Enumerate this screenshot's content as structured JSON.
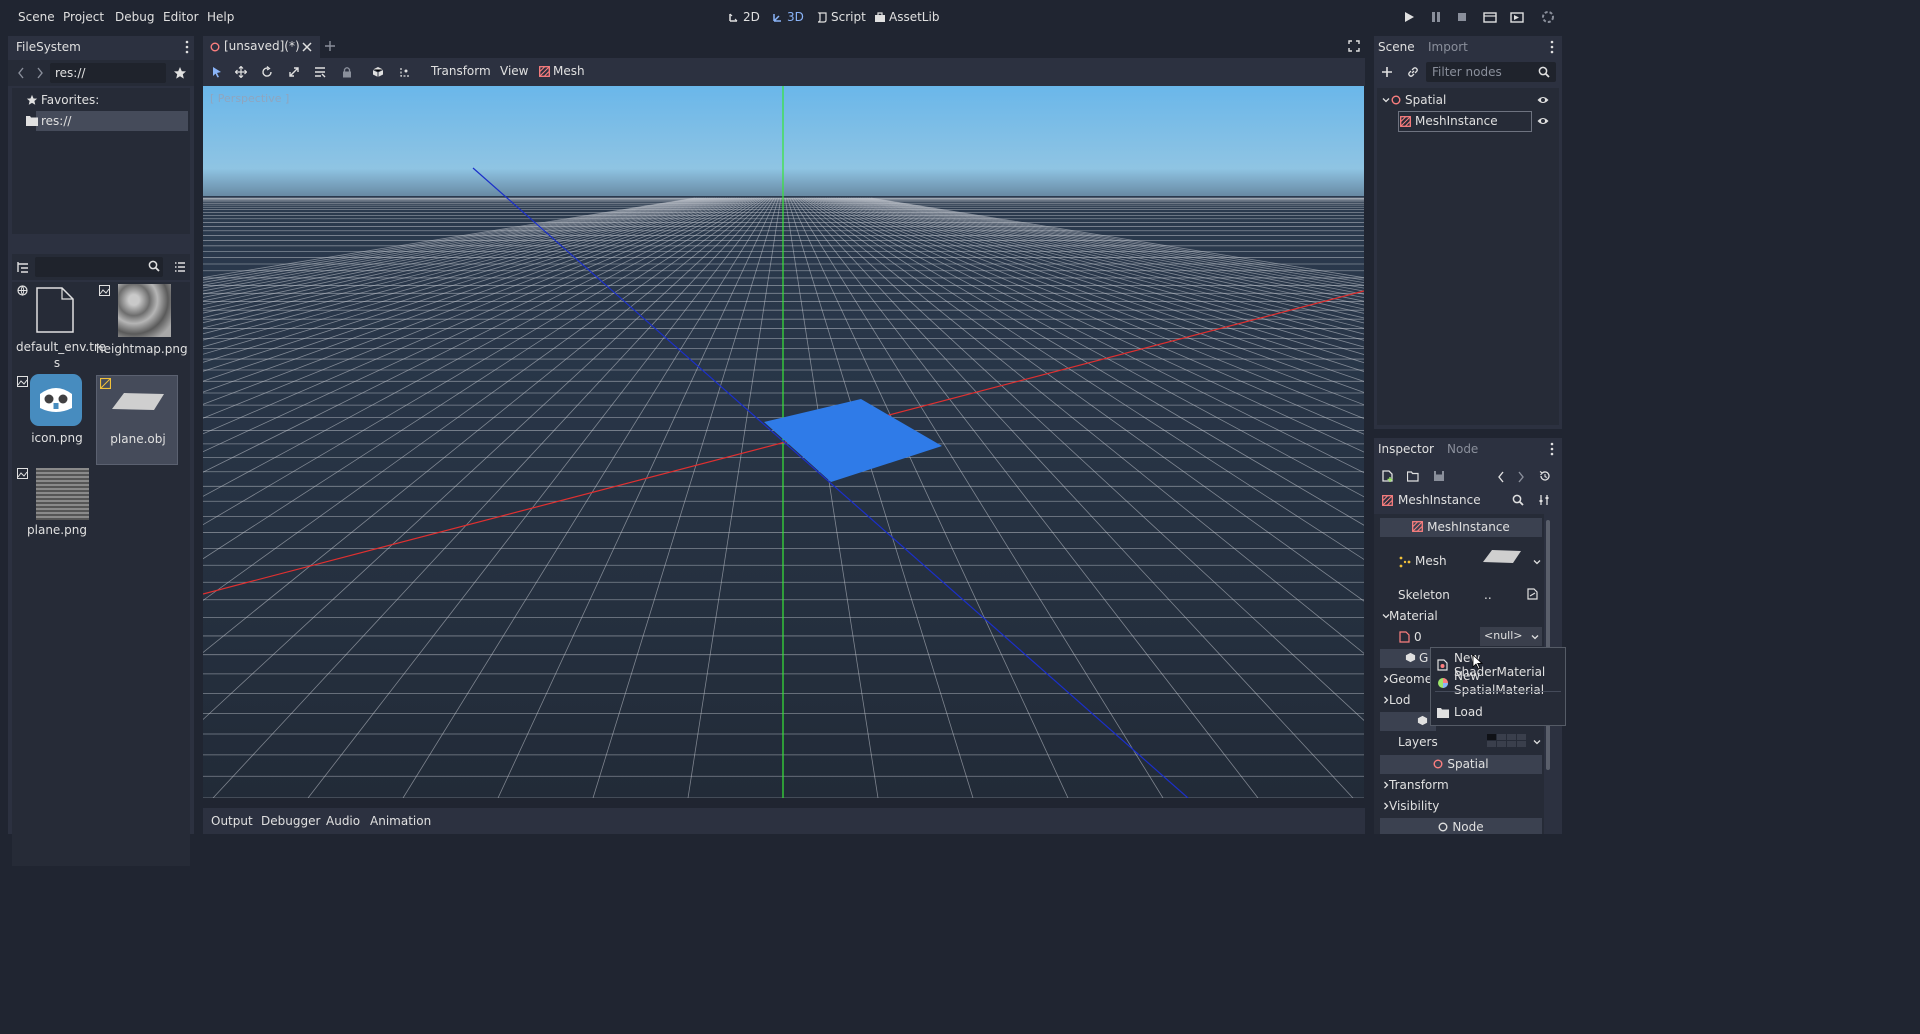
{
  "menu": {
    "items": [
      "Scene",
      "Project",
      "Debug",
      "Editor",
      "Help"
    ]
  },
  "workspaces": {
    "items": [
      "2D",
      "3D",
      "Script",
      "AssetLib"
    ]
  },
  "filesystem": {
    "title": "FileSystem",
    "path": "res://",
    "favorites_label": "Favorites:",
    "root_label": "res://",
    "files": [
      {
        "name": "default_env.tres",
        "line1": "default_env.tre",
        "line2": "s"
      },
      {
        "name": "heightmap.png"
      },
      {
        "name": "icon.png"
      },
      {
        "name": "plane.obj"
      },
      {
        "name": "plane.png"
      }
    ]
  },
  "editor": {
    "tab_label": "[unsaved](*)",
    "toolbar": {
      "transform": "Transform",
      "view": "View",
      "mesh": "Mesh"
    },
    "viewport_label": "[ Perspective ]",
    "bottom_tabs": [
      "Output",
      "Debugger",
      "Audio",
      "Animation"
    ]
  },
  "scene_panel": {
    "tabs": [
      "Scene",
      "Import"
    ],
    "filter_placeholder": "Filter nodes",
    "tree": [
      {
        "label": "Spatial"
      },
      {
        "label": "MeshInstance"
      }
    ]
  },
  "inspector": {
    "tabs": [
      "Inspector",
      "Node"
    ],
    "object_name": "MeshInstance",
    "section_meshinstance": "MeshInstance",
    "mesh_label": "Mesh",
    "skeleton_label": "Skeleton",
    "skeleton_value": "..",
    "material_label": "Material",
    "material_index": "0",
    "material_value": "<null>",
    "geometry_partial": "Geome",
    "geometry_short": "G",
    "lod_label": "Lod",
    "layers_label": "Layers",
    "section_spatial": "Spatial",
    "transform_label": "Transform",
    "visibility_label": "Visibility",
    "section_node": "Node"
  },
  "popup": {
    "items": [
      "New ShaderMaterial",
      "New SpatialMaterial",
      "Load"
    ]
  },
  "colors": {
    "accent": "#699ce8",
    "plane_blue": "#2f7be8",
    "background": "#202531",
    "panel": "#2c3140"
  }
}
